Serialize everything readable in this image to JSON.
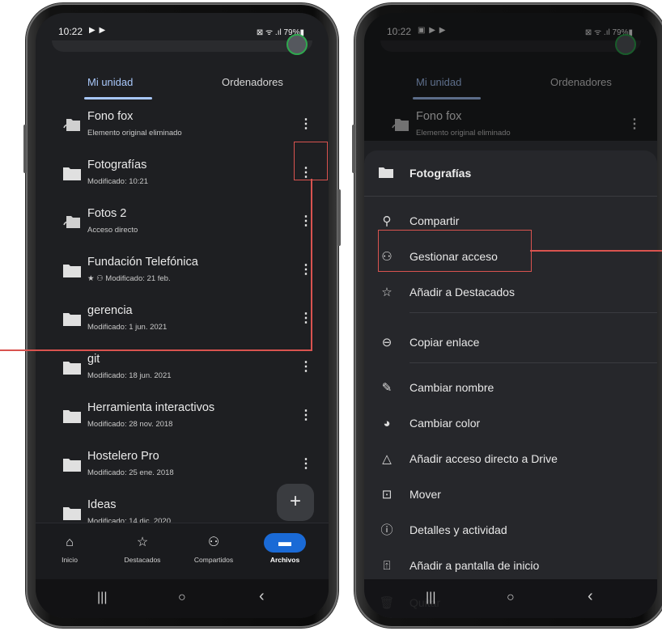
{
  "left_phone": {
    "status": {
      "time": "10:22",
      "icons_left": "▶ ▶",
      "icons_right": "⊠ ᯤ .ıl 79%▮"
    },
    "tabs": [
      {
        "label": "Mi unidad"
      },
      {
        "label": "Ordenadores"
      }
    ],
    "files": [
      {
        "name": "Fono fox",
        "sub": "Elemento original eliminado",
        "icon": "shortcut-folder-icon"
      },
      {
        "name": "Fotografías",
        "sub": "Modificado: 10:21",
        "icon": "folder-icon"
      },
      {
        "name": "Fotos 2",
        "sub": "Acceso directo",
        "icon": "shortcut-folder-icon"
      },
      {
        "name": "Fundación Telefónica",
        "sub": "★ ⚇ Modificado: 21 feb.",
        "icon": "folder-icon"
      },
      {
        "name": "gerencia",
        "sub": "Modificado: 1 jun. 2021",
        "icon": "folder-icon"
      },
      {
        "name": "git",
        "sub": "Modificado: 18 jun. 2021",
        "icon": "folder-icon"
      },
      {
        "name": "Herramienta interactivos",
        "sub": "Modificado: 28 nov. 2018",
        "icon": "folder-icon"
      },
      {
        "name": "Hostelero Pro",
        "sub": "Modificado: 25 ene. 2018",
        "icon": "folder-icon"
      },
      {
        "name": "Ideas",
        "sub": "Modificado: 14 dic. 2020",
        "icon": "folder-icon"
      }
    ],
    "fab": "+",
    "bottom_nav": [
      {
        "label": "Inicio",
        "icon": "home-icon",
        "glyph": "⌂"
      },
      {
        "label": "Destacados",
        "icon": "star-icon",
        "glyph": "☆"
      },
      {
        "label": "Compartidos",
        "icon": "people-icon",
        "glyph": "⚇"
      },
      {
        "label": "Archivos",
        "icon": "folder-icon",
        "glyph": "▬"
      }
    ],
    "system_nav": {
      "recents": "|||",
      "home": "○",
      "back": "‹"
    }
  },
  "right_phone": {
    "status": {
      "time": "10:22",
      "icons_left": "▣ ▶ ▶",
      "icons_right": "⊠ ᯤ .ıl 79%▮"
    },
    "tabs": [
      {
        "label": "Mi unidad"
      },
      {
        "label": "Ordenadores"
      }
    ],
    "bg_file": {
      "name": "Fono fox",
      "sub": "Elemento original eliminado"
    },
    "sheet_title": "Fotografías",
    "menu": [
      {
        "label": "Compartir",
        "icon": "share-person-icon",
        "glyph": "⚲"
      },
      {
        "label": "Gestionar acceso",
        "icon": "manage-access-icon",
        "glyph": "⚇"
      },
      {
        "label": "Añadir a Destacados",
        "icon": "star-icon",
        "glyph": "☆"
      },
      {
        "label": "Copiar enlace",
        "icon": "link-icon",
        "glyph": "⊖"
      },
      {
        "label": "Cambiar nombre",
        "icon": "pencil-icon",
        "glyph": "✎"
      },
      {
        "label": "Cambiar color",
        "icon": "palette-icon",
        "glyph": "◕"
      },
      {
        "label": "Añadir acceso directo a Drive",
        "icon": "drive-shortcut-icon",
        "glyph": "△"
      },
      {
        "label": "Mover",
        "icon": "move-icon",
        "glyph": "⊡"
      },
      {
        "label": "Detalles y actividad",
        "icon": "info-icon",
        "glyph": "ⓘ"
      },
      {
        "label": "Añadir a pantalla de inicio",
        "icon": "add-home-icon",
        "glyph": "⍐"
      },
      {
        "label": "Quitar",
        "icon": "trash-icon",
        "glyph": "🗑"
      }
    ],
    "system_nav": {
      "recents": "|||",
      "home": "○",
      "back": "‹"
    }
  },
  "colors": {
    "accent": "#a8c7fa",
    "highlight": "#d9534f",
    "nav_active": "#1a6ad6"
  }
}
